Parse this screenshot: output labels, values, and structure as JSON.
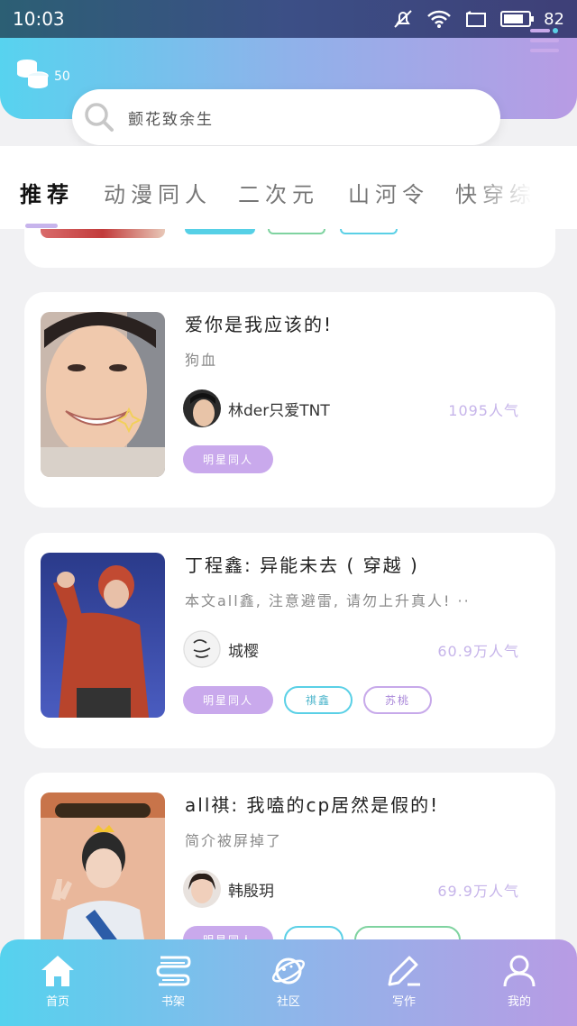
{
  "status": {
    "time": "10:03",
    "battery": "82",
    "battery_fraction": 0.82
  },
  "header": {
    "coins": "50"
  },
  "search": {
    "text": "颤花致余生"
  },
  "tabs": [
    {
      "label": "推荐"
    },
    {
      "label": "动漫同人"
    },
    {
      "label": "二次元"
    },
    {
      "label": "山河令"
    },
    {
      "label": "快穿综"
    }
  ],
  "cards": [
    {
      "title": "爱你是我应该的!",
      "desc": "狗血",
      "author": "林der只爱TNT",
      "popularity": "1095人气",
      "tags": [
        "明星同人"
      ]
    },
    {
      "title": "丁程鑫: 异能未去 ( 穿越 )",
      "desc": "本文all鑫, 注意避雷, 请勿上升真人! ··",
      "author": "城樱",
      "popularity": "60.9万人气",
      "tags": [
        "明星同人",
        "祺鑫",
        "苏桃"
      ]
    },
    {
      "title": "all祺: 我嗑的cp居然是假的!",
      "desc": "简介被屏掉了",
      "author": "韩殷玥",
      "popularity": "69.9万人气",
      "tags": [
        "明星同人",
        "",
        ""
      ]
    }
  ],
  "nav": [
    {
      "label": "首页",
      "icon": "home-icon"
    },
    {
      "label": "书架",
      "icon": "bookshelf-icon"
    },
    {
      "label": "社区",
      "icon": "planet-icon"
    },
    {
      "label": "写作",
      "icon": "pen-icon"
    },
    {
      "label": "我的",
      "icon": "person-icon"
    }
  ]
}
